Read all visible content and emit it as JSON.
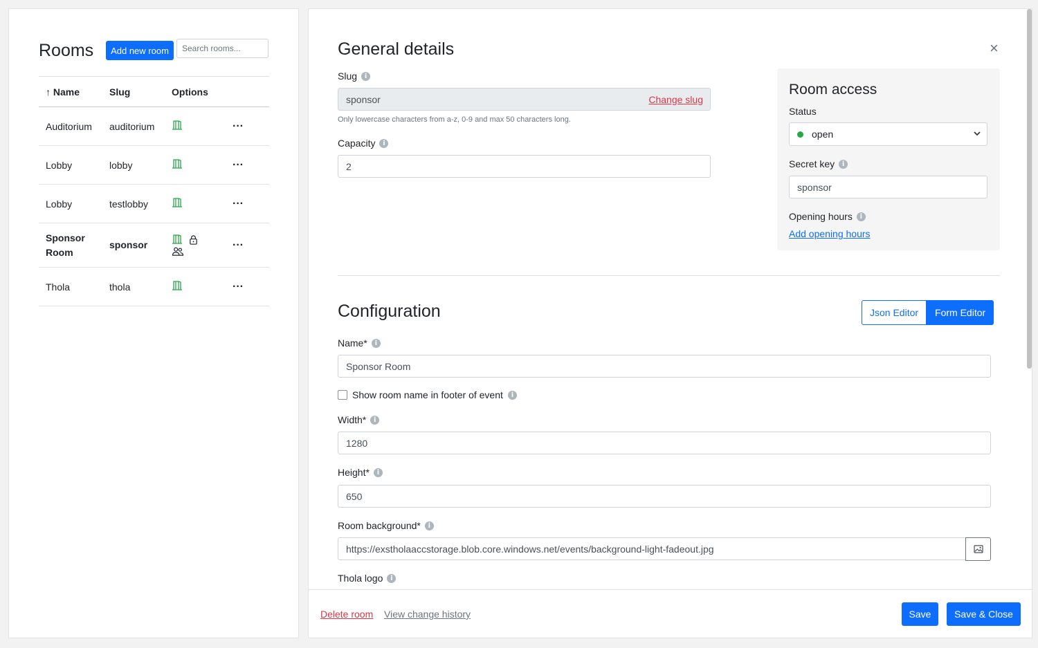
{
  "rooms_panel": {
    "title": "Rooms",
    "add_button": "Add new room",
    "search_placeholder": "Search rooms...",
    "columns": {
      "name": "Name",
      "slug": "Slug",
      "options": "Options"
    },
    "sort_indicator": "↑",
    "rows": [
      {
        "name": "Auditorium",
        "slug": "auditorium"
      },
      {
        "name": "Lobby",
        "slug": "lobby"
      },
      {
        "name": "Lobby",
        "slug": "testlobby"
      },
      {
        "name": "Sponsor Room",
        "slug": "sponsor"
      },
      {
        "name": "Thola",
        "slug": "thola"
      }
    ],
    "row_menu_label": "···"
  },
  "general": {
    "title": "General details",
    "slug_label": "Slug",
    "slug_value": "sponsor",
    "change_slug": "Change slug",
    "slug_hint": "Only lowercase characters from a-z, 0-9 and max 50 characters long.",
    "capacity_label": "Capacity",
    "capacity_value": "2",
    "close": "×"
  },
  "room_access": {
    "title": "Room access",
    "status_label": "Status",
    "status_value": "open",
    "status_color": "#28a745",
    "secret_key_label": "Secret key",
    "secret_key_value": "sponsor",
    "opening_hours_label": "Opening hours",
    "add_opening_hours": "Add opening hours"
  },
  "configuration": {
    "title": "Configuration",
    "json_editor": "Json Editor",
    "form_editor": "Form Editor",
    "name_label": "Name*",
    "name_value": "Sponsor Room",
    "show_name_label": "Show room name in footer of event",
    "width_label": "Width*",
    "width_value": "1280",
    "height_label": "Height*",
    "height_value": "650",
    "background_label": "Room background*",
    "background_value": "https://exstholaaccstorage.blob.core.windows.net/events/background-light-fadeout.jpg",
    "logo_label": "Thola logo"
  },
  "footer": {
    "delete_room": "Delete room",
    "view_history": "View change history",
    "save": "Save",
    "save_close": "Save & Close"
  },
  "icons": {
    "info": "i"
  },
  "colors": {
    "primary": "#0d6efd",
    "danger": "#dc3545",
    "success": "#28a745"
  }
}
